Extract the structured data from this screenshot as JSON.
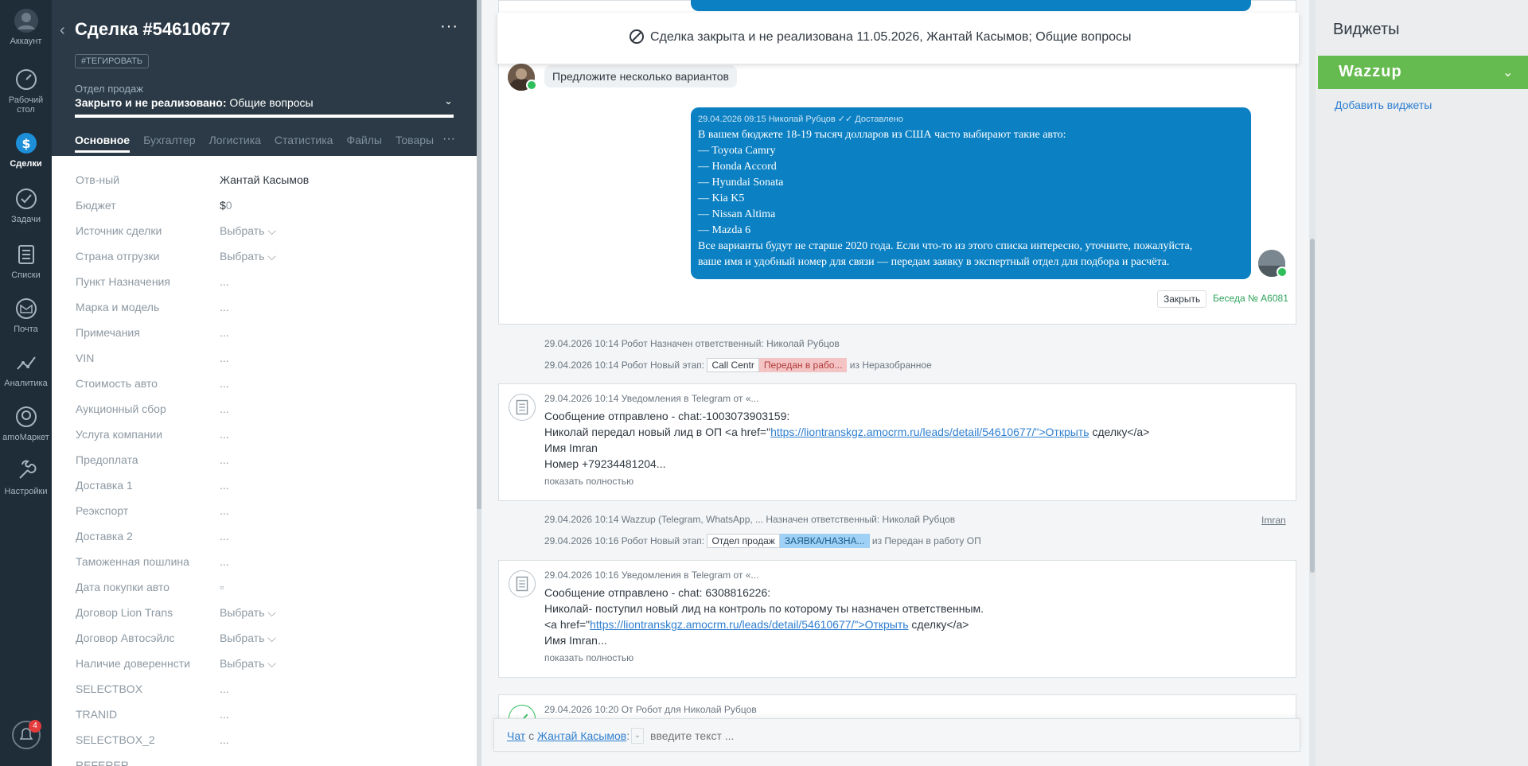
{
  "nav": {
    "items": [
      {
        "label": "Аккаунт",
        "icon": "user-icon"
      },
      {
        "label": "Рабочий стол",
        "icon": "dashboard-icon"
      },
      {
        "label": "Сделки",
        "icon": "deals-icon"
      },
      {
        "label": "Задачи",
        "icon": "tasks-icon"
      },
      {
        "label": "Списки",
        "icon": "lists-icon"
      },
      {
        "label": "Почта",
        "icon": "mail-icon"
      },
      {
        "label": "Аналитика",
        "icon": "analytics-icon"
      },
      {
        "label": "amoМаркет",
        "icon": "market-icon"
      },
      {
        "label": "Настройки",
        "icon": "settings-icon"
      }
    ],
    "notifications_count": "4"
  },
  "card": {
    "title": "Сделка #54610677",
    "tag": "#ТЕГИРОВАТЬ",
    "pipeline_label": "Отдел продаж",
    "pipeline_status": "Закрыто и не реализовано:",
    "pipeline_value": " Общие вопросы",
    "tabs": [
      "Основное",
      "Бухгалтер",
      "Логистика",
      "Статистика",
      "Файлы",
      "Товары"
    ],
    "more": "···"
  },
  "fields": [
    {
      "label": "Отв-ный",
      "value": "Жантай Касымов"
    },
    {
      "label": "Бюджет",
      "value": "$",
      "value_zero": "0"
    },
    {
      "label": "Источник сделки",
      "value": "Выбрать ⌵"
    },
    {
      "label": "Страна отгрузки",
      "value": "Выбрать ⌵"
    },
    {
      "label": "Пункт Назначения",
      "value": "..."
    },
    {
      "label": "Марка и модель",
      "value": "..."
    },
    {
      "label": "Примечания",
      "value": "..."
    },
    {
      "label": "VIN",
      "value": "..."
    },
    {
      "label": "Стоимость авто",
      "value": "..."
    },
    {
      "label": "Аукционный сбор",
      "value": "..."
    },
    {
      "label": "Услуга компании",
      "value": "..."
    },
    {
      "label": "Предоплата",
      "value": "..."
    },
    {
      "label": "Доставка 1",
      "value": "..."
    },
    {
      "label": "Реэкспорт",
      "value": "..."
    },
    {
      "label": "Доставка 2",
      "value": "..."
    },
    {
      "label": "Таможенная пошлина",
      "value": "..."
    },
    {
      "label": "Дата покупки авто",
      "value": "▫"
    },
    {
      "label": "Договор Lion Trans",
      "value": "Выбрать ⌵"
    },
    {
      "label": "Договор Автосэйлс",
      "value": "Выбрать ⌵"
    },
    {
      "label": "Наличие довереннсти",
      "value": "Выбрать ⌵"
    },
    {
      "label": "SELECTBOX",
      "value": "..."
    },
    {
      "label": "TRANID",
      "value": "..."
    },
    {
      "label": "SELECTBOX_2",
      "value": "..."
    },
    {
      "label": "REFERER",
      "value": ""
    }
  ],
  "feed": {
    "banner": "Сделка закрыта и не реализована 11.05.2026, Жантай Касымов; Общие вопросы",
    "incoming_msg": "Предложите несколько вариантов",
    "outgoing_meta": "29.04.2026 09:15 Николай Рубцов ✓✓ Доставлено",
    "outgoing_lines": [
      "В вашем бюджете 18-19 тысяч долларов из США часто выбирают такие авто:",
      "— Toyota Camry",
      "— Honda Accord",
      "— Hyundai Sonata",
      "— Kia K5",
      "— Nissan Altima",
      "— Mazda 6",
      "Все варианты будут не старше 2020 года. Если что-то из этого списка интересно, уточните, пожалуйста,",
      "ваше имя и удобный номер для связи — передам заявку в экспертный отдел для подбора и расчёта."
    ],
    "close_label": "Закрыть",
    "conversation_label": "Беседа № А6081",
    "event1": "29.04.2026 10:14 Робот Назначен ответственный: Николай Рубцов",
    "event2_prefix": "29.04.2026 10:14 Робот Новый этап:",
    "event2_from": "Call Centr",
    "event2_stage": "Передан в рабо...",
    "event2_suffix": "из Неразобранное",
    "note1": {
      "meta": "29.04.2026 10:14 Уведомления в Telegram от «...",
      "line1": "Сообщение отправлено - chat:-1003073903159:",
      "line2_pre": "Николай передал новый лид в ОП <a href=\"",
      "line2_link": "https://liontranskgz.amocrm.ru/leads/detail/54610677/\">Открыть",
      "line2_post": " сделку</a>",
      "line3": "Имя Imran",
      "line4": "Номер +79234481204...",
      "more": "показать полностью"
    },
    "event3": "29.04.2026 10:14 Wazzup (Telegram, WhatsApp, ... Назначен ответственный: Николай Рубцов",
    "event3_link": "Imran",
    "event4_prefix": "29.04.2026 10:16 Робот Новый этап:",
    "event4_from": "Отдел продаж",
    "event4_stage": "ЗАЯВКА/НАЗНА...",
    "event4_suffix": "из Передан в работу ОП",
    "note2": {
      "meta": "29.04.2026 10:16 Уведомления в Telegram от «...",
      "line1": "Сообщение отправлено - chat: 6308816226:",
      "line2": "Николай- поступил новый лид на контроль по которому ты назначен ответственным.",
      "line3_pre": "<a href=\"",
      "line3_link": "https://liontranskgz.amocrm.ru/leads/detail/54610677/\">Открыть",
      "line3_post": " сделку</a>",
      "line4": "Имя Imran...",
      "more": "показать полностью"
    },
    "note3_meta": "29.04.2026 10:20  От Робот для Николай Рубцов",
    "chat": {
      "label_prefix": "Чат",
      "label_mid": " с ",
      "label_contact": "Жантай Касымов",
      "label_colon": ":",
      "placeholder": "введите текст ..."
    }
  },
  "widgets": {
    "title": "Виджеты",
    "wazzup": "Wazzup",
    "add": "Добавить виджеты"
  },
  "colors": {
    "nav_bg": "#1f2d39",
    "card_head_bg": "#2b3a46",
    "bubble_blue": "#0b80c2",
    "wazzup_green": "#66bb50"
  }
}
